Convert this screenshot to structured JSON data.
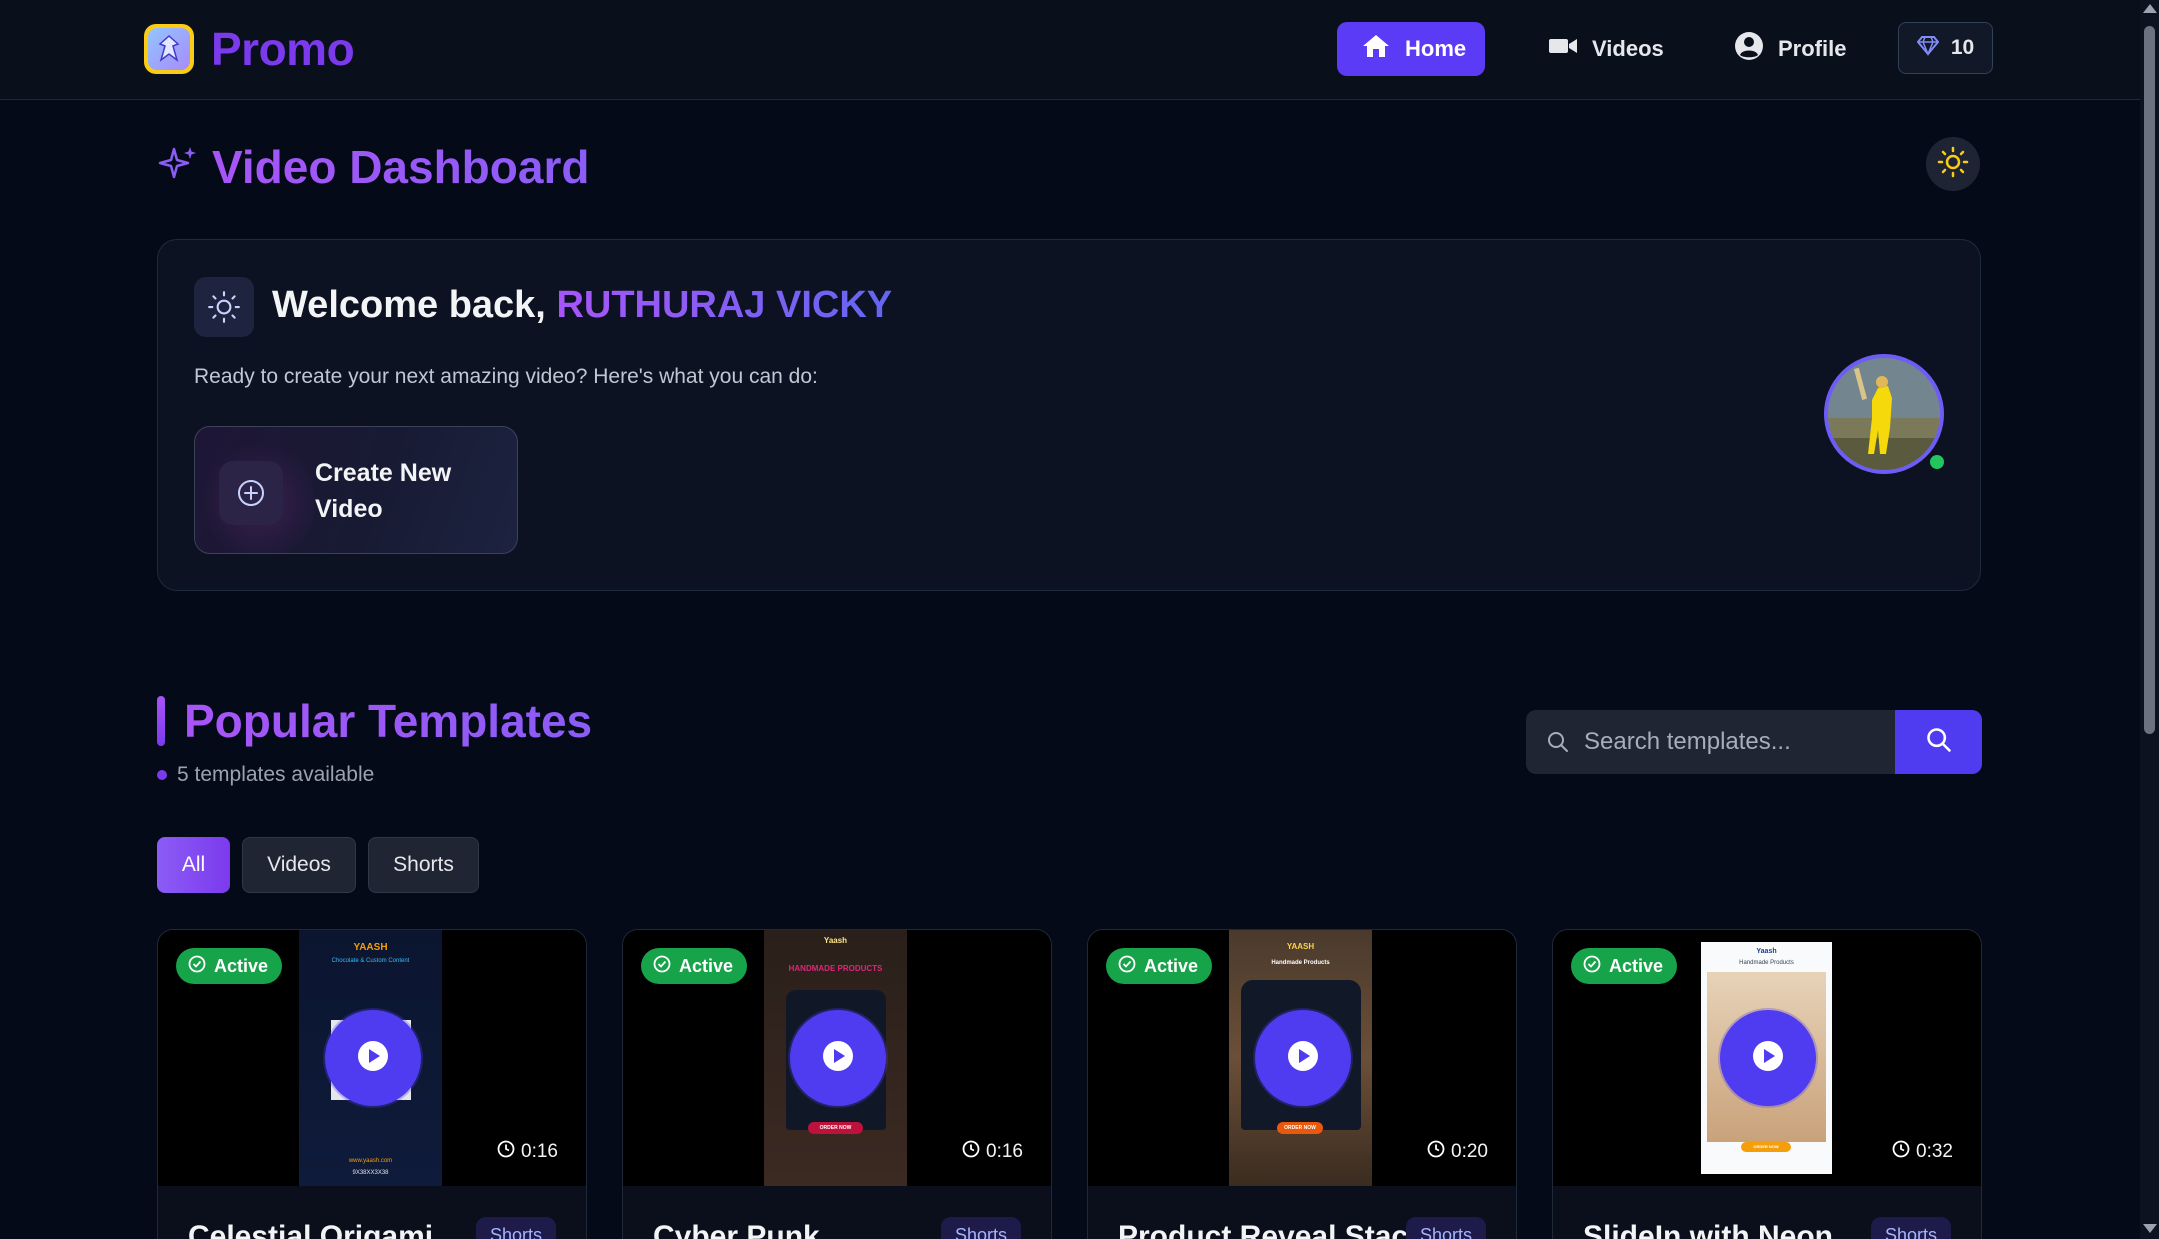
{
  "nav": {
    "brand": "Promo",
    "home": "Home",
    "videos": "Videos",
    "profile": "Profile",
    "gems": "10"
  },
  "dashboard": {
    "title": "Video Dashboard"
  },
  "welcome": {
    "greeting": "Welcome back,",
    "user_name": "RUTHURAJ VICKY",
    "subtitle": "Ready to create your next amazing video? Here's what you can do:",
    "create_label": "Create New Video"
  },
  "templates": {
    "title": "Popular Templates",
    "count_text": "5 templates available",
    "search_placeholder": "Search templates...",
    "filters": [
      "All",
      "Videos",
      "Shorts"
    ],
    "active_filter": "All",
    "cards": [
      {
        "status": "Active",
        "duration": "0:16",
        "title": "Celestial Origami",
        "tag": "Shorts",
        "poster_brand": "YAASH",
        "poster_sub": "Chocolate & Custom Content",
        "poster_url": "www.yaash.com",
        "poster_phone": "9X38XX3X38"
      },
      {
        "status": "Active",
        "duration": "0:16",
        "title": "Cyber Punk",
        "tag": "Shorts",
        "poster_brand": "Yaash",
        "poster_headline": "HANDMADE PRODUCTS",
        "poster_cta": "ORDER NOW"
      },
      {
        "status": "Active",
        "duration": "0:20",
        "title": "Product Reveal Stack",
        "tag": "Shorts",
        "poster_brand": "YAASH",
        "poster_headline": "Handmade Products",
        "poster_cta": "ORDER NOW"
      },
      {
        "status": "Active",
        "duration": "0:32",
        "title": "SlideIn with Neon",
        "tag": "Shorts",
        "poster_brand": "Yaash",
        "poster_headline": "Handmade Products",
        "poster_cta": "ORDER NOW"
      }
    ]
  },
  "colors": {
    "accent": "#5b3bf6",
    "brand_purple": "#7c3aed",
    "active_green": "#16a34a",
    "background": "#050a18"
  }
}
